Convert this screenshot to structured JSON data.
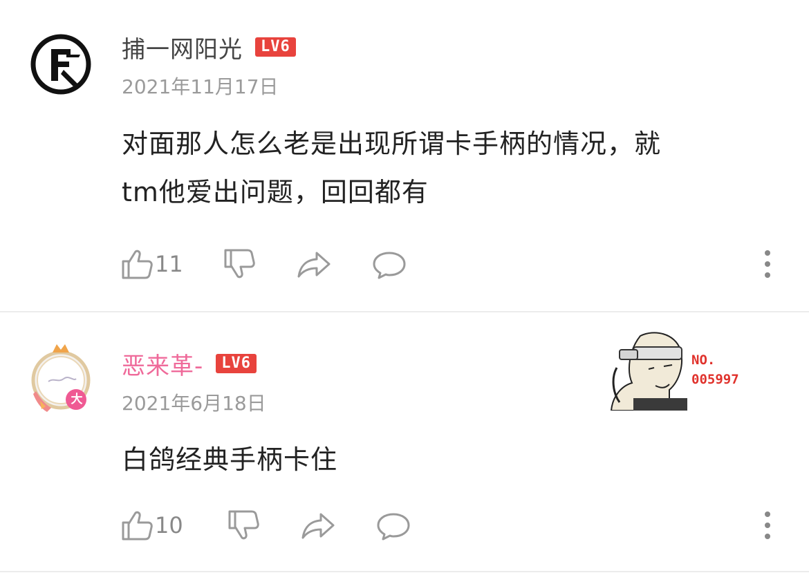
{
  "comments": [
    {
      "username": "捕一网阳光",
      "level": "LV6",
      "timestamp": "2021年11月17日",
      "text_line1": "对面那人怎么老是出现所谓卡手柄的情况，就",
      "text_line2": "tm他爱出问题，回回都有",
      "likes": "11",
      "avatar_icon": "black-circle-logo-avatar"
    },
    {
      "username": "恶来革-",
      "level": "LV6",
      "timestamp": "2021年6月18日",
      "text": "白鸽经典手柄卡住",
      "likes": "10",
      "avatar_icon": "crown-frame-avatar",
      "avatar_badge": "大",
      "sticker_text_1": "NO.",
      "sticker_text_2": "005997"
    }
  ],
  "colors": {
    "level_badge": "#e8433d",
    "pink_name": "#ef6a9a",
    "icon_gray": "#9a9a9a"
  }
}
